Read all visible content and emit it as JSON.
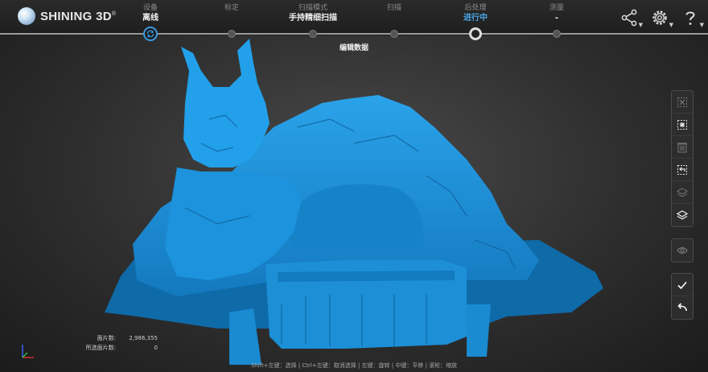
{
  "brand": {
    "name": "SHINING 3D",
    "mark": "®"
  },
  "steps": [
    {
      "label": "设备",
      "value": "离线",
      "state": "done"
    },
    {
      "label": "标定",
      "value": "",
      "state": "pending"
    },
    {
      "label": "扫描模式",
      "value": "手持精细扫描",
      "state": "pending"
    },
    {
      "label": "扫描",
      "value": "",
      "state": "pending"
    },
    {
      "label": "后处理",
      "value": "进行中",
      "state": "current"
    },
    {
      "label": "测量",
      "value": "-",
      "state": "pending"
    }
  ],
  "subtitle": "编辑数据",
  "top_icons": [
    "share-icon",
    "settings-icon",
    "help-icon"
  ],
  "toolbar": {
    "group1": [
      "clear-selection-icon",
      "select-visible-icon",
      "delete-icon",
      "undo-icon",
      "layers-icon",
      "layers-active-icon"
    ],
    "group2": [
      "visibility-icon"
    ],
    "group3": [
      "apply-check-icon",
      "back-arrow-icon"
    ]
  },
  "stats": {
    "faces_label": "面片数:",
    "faces_value": "2,986,355",
    "selected_label": "所选面片数:",
    "selected_value": "0"
  },
  "hint": "Shift+左键：选择 | Ctrl+左键：取消选择 | 左键：旋转 | 中键：平移 | 滚轮：缩放",
  "colors": {
    "accent": "#3a9be0",
    "model": "#1b8fd6",
    "background": "#2e2e2e"
  }
}
